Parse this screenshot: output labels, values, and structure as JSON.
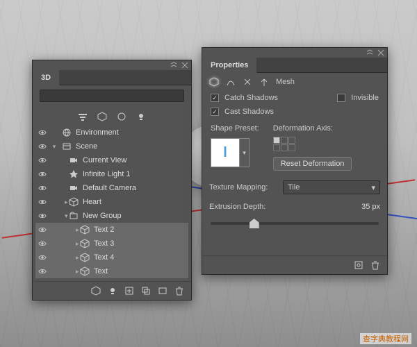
{
  "panel3d": {
    "title": "3D",
    "items": [
      {
        "icon": "env",
        "label": "Environment",
        "depth": 0,
        "twisty": "",
        "sel": false
      },
      {
        "icon": "scene",
        "label": "Scene",
        "depth": 0,
        "twisty": "v",
        "sel": false
      },
      {
        "icon": "camera",
        "label": "Current View",
        "depth": 1,
        "twisty": "",
        "sel": false
      },
      {
        "icon": "light",
        "label": "Infinite Light 1",
        "depth": 1,
        "twisty": "",
        "sel": false
      },
      {
        "icon": "camera",
        "label": "Default Camera",
        "depth": 1,
        "twisty": "",
        "sel": false
      },
      {
        "icon": "mesh",
        "label": "Heart",
        "depth": 1,
        "twisty": ">",
        "sel": false
      },
      {
        "icon": "group",
        "label": "New Group",
        "depth": 1,
        "twisty": "v",
        "sel": false
      },
      {
        "icon": "mesh",
        "label": "Text 2",
        "depth": 2,
        "twisty": ">",
        "sel": true
      },
      {
        "icon": "mesh",
        "label": "Text 3",
        "depth": 2,
        "twisty": ">",
        "sel": true
      },
      {
        "icon": "mesh",
        "label": "Text 4",
        "depth": 2,
        "twisty": ">",
        "sel": true
      },
      {
        "icon": "mesh",
        "label": "Text",
        "depth": 2,
        "twisty": ">",
        "sel": true
      }
    ]
  },
  "props": {
    "title": "Properties",
    "meshLabel": "Mesh",
    "catchShadows": "Catch Shadows",
    "castShadows": "Cast Shadows",
    "invisible": "Invisible",
    "shapePreset": "Shape Preset:",
    "deformAxis": "Deformation Axis:",
    "resetDeform": "Reset Deformation",
    "textureMapping": "Texture Mapping:",
    "textureValue": "Tile",
    "extrusionDepth": "Extrusion Depth:",
    "extrusionValue": "35 px",
    "swatchGlyph": "l"
  },
  "watermark": "查字典教程网"
}
